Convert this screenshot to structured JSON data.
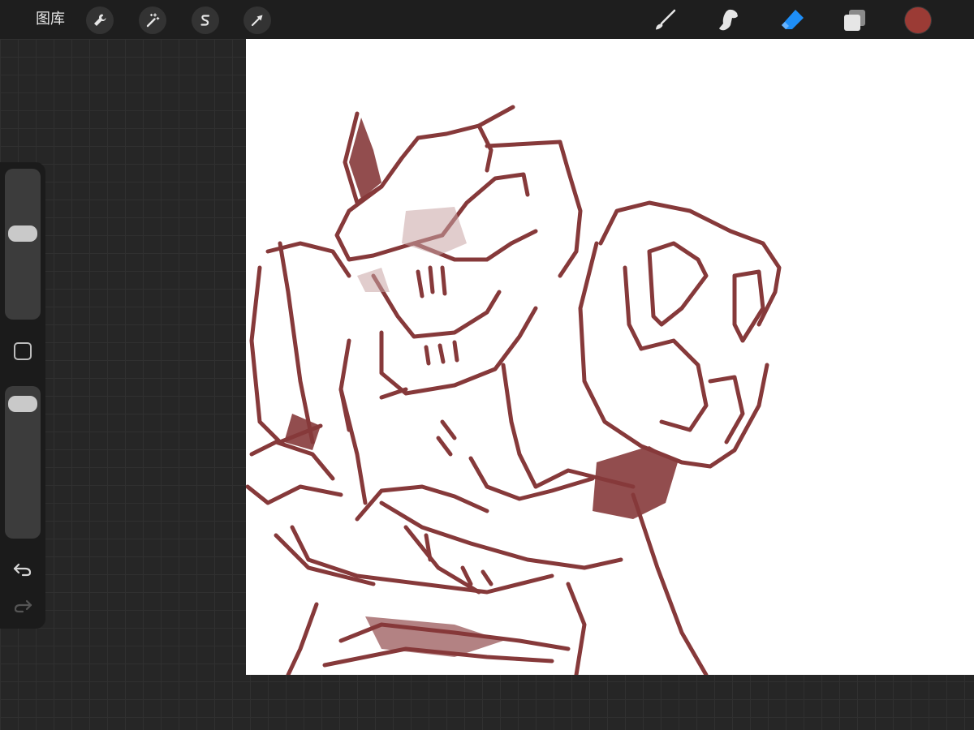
{
  "topbar": {
    "gallery_label": "图库",
    "left_tools": [
      {
        "icon": "wrench-icon",
        "name": "actions"
      },
      {
        "icon": "magic-wand-icon",
        "name": "adjustments"
      },
      {
        "icon": "selection-s-icon",
        "name": "selection"
      },
      {
        "icon": "arrow-cursor-icon",
        "name": "transform"
      }
    ],
    "right_tools": [
      {
        "icon": "brush-icon",
        "name": "paint"
      },
      {
        "icon": "smudge-icon",
        "name": "smudge"
      },
      {
        "icon": "eraser-icon",
        "name": "erase",
        "active": true
      },
      {
        "icon": "layers-icon",
        "name": "layers"
      }
    ],
    "current_color": "#9b3b35",
    "active_tool_color": "#1e8ef7"
  },
  "sidebar": {
    "brush_size_level": 0.58,
    "opacity_level": 0.05,
    "buttons": [
      "modify-square-icon",
      "undo-icon",
      "redo-icon"
    ]
  },
  "canvas": {
    "background": "#ffffff",
    "stroke_color": "#86393a",
    "subject": "robot-sketch"
  }
}
